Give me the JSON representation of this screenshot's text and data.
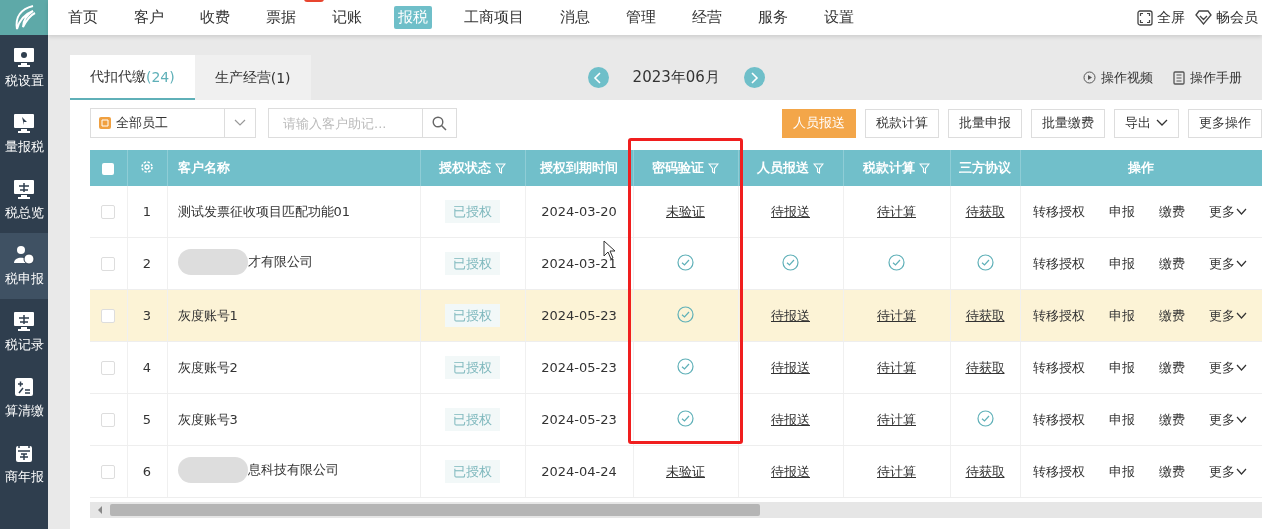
{
  "sidebar": {
    "items": [
      {
        "label": "税设置",
        "kind": "settings",
        "selected": false
      },
      {
        "label": "量报税",
        "kind": "batch",
        "selected": false
      },
      {
        "label": "税总览",
        "kind": "overview",
        "selected": false
      },
      {
        "label": "税申报",
        "kind": "declare",
        "selected": true
      },
      {
        "label": "税记录",
        "kind": "record",
        "selected": false
      },
      {
        "label": "算清缴",
        "kind": "settle",
        "selected": false
      },
      {
        "label": "商年报",
        "kind": "annual",
        "selected": false
      }
    ]
  },
  "nav": {
    "items": [
      {
        "label": "首页",
        "selected": false,
        "badge": false
      },
      {
        "label": "客户",
        "selected": false,
        "badge": false
      },
      {
        "label": "收费",
        "selected": false,
        "badge": false
      },
      {
        "label": "票据",
        "selected": false,
        "badge": true
      },
      {
        "label": "记账",
        "selected": false,
        "badge": false
      },
      {
        "label": "报税",
        "selected": true,
        "badge": false
      },
      {
        "label": "工商项目",
        "selected": false,
        "badge": false
      },
      {
        "label": "消息",
        "selected": false,
        "badge": false
      },
      {
        "label": "管理",
        "selected": false,
        "badge": false
      },
      {
        "label": "经营",
        "selected": false,
        "badge": false
      },
      {
        "label": "服务",
        "selected": false,
        "badge": false
      },
      {
        "label": "设置",
        "selected": false,
        "badge": false
      }
    ],
    "right": [
      {
        "label": "全屏",
        "kind": "fullscreen"
      },
      {
        "label": "畅会员",
        "kind": "vip"
      }
    ]
  },
  "tabs": [
    {
      "label": "代扣代缴",
      "count": "(24)",
      "selected": true
    },
    {
      "label": "生产经营",
      "count": "(1)",
      "selected": false
    }
  ],
  "period": "2023年06月",
  "help_links": [
    {
      "label": "操作视频",
      "kind": "video"
    },
    {
      "label": "操作手册",
      "kind": "manual"
    }
  ],
  "filter": {
    "value": "全部员工"
  },
  "search": {
    "placeholder": "请输入客户助记..."
  },
  "actions": [
    {
      "label": "人员报送",
      "primary": true,
      "dropdown": false
    },
    {
      "label": "税款计算",
      "primary": false,
      "dropdown": false
    },
    {
      "label": "批量申报",
      "primary": false,
      "dropdown": false
    },
    {
      "label": "批量缴费",
      "primary": false,
      "dropdown": false
    },
    {
      "label": "导出",
      "primary": false,
      "dropdown": true
    },
    {
      "label": "更多操作",
      "primary": false,
      "dropdown": false
    }
  ],
  "table": {
    "columns": [
      {
        "kind": "check",
        "checked": false
      },
      {
        "kind": "settings"
      },
      {
        "label": "客户名称",
        "filter": false,
        "highlighted": false
      },
      {
        "label": "授权状态",
        "filter": true,
        "highlighted": false
      },
      {
        "label": "授权到期时间",
        "filter": false,
        "highlighted": false
      },
      {
        "label": "密码验证",
        "filter": true,
        "highlighted": true
      },
      {
        "label": "人员报送",
        "filter": true,
        "highlighted": false
      },
      {
        "label": "税款计算",
        "filter": true,
        "highlighted": false
      },
      {
        "label": "三方协议",
        "filter": false,
        "highlighted": false
      },
      {
        "label": "操作",
        "filter": false,
        "highlighted": false
      }
    ],
    "rows": [
      {
        "checked": false,
        "highlighted": false,
        "no": "1",
        "name": "测试发票征收项目匹配功能01",
        "redacted": false,
        "auth": "已授权",
        "expiry": "2024-03-20",
        "status": [
          {
            "kind": "link",
            "text": "未验证"
          },
          {
            "kind": "link",
            "text": "待报送"
          },
          {
            "kind": "link",
            "text": "待计算"
          },
          {
            "kind": "link",
            "text": "待获取"
          }
        ],
        "ops": [
          "转移授权",
          "申报",
          "缴费",
          "更多"
        ]
      },
      {
        "checked": false,
        "highlighted": false,
        "no": "2",
        "name": "才有限公司",
        "redacted": true,
        "auth": "已授权",
        "expiry": "2024-03-21",
        "status": [
          {
            "kind": "check"
          },
          {
            "kind": "check"
          },
          {
            "kind": "check"
          },
          {
            "kind": "check"
          }
        ],
        "ops": [
          "转移授权",
          "申报",
          "缴费",
          "更多"
        ]
      },
      {
        "checked": false,
        "highlighted": true,
        "no": "3",
        "name": "灰度账号1",
        "redacted": false,
        "auth": "已授权",
        "expiry": "2024-05-23",
        "status": [
          {
            "kind": "check"
          },
          {
            "kind": "link",
            "text": "待报送"
          },
          {
            "kind": "link",
            "text": "待计算"
          },
          {
            "kind": "link",
            "text": "待获取"
          }
        ],
        "ops": [
          "转移授权",
          "申报",
          "缴费",
          "更多"
        ]
      },
      {
        "checked": false,
        "highlighted": false,
        "no": "4",
        "name": "灰度账号2",
        "redacted": false,
        "auth": "已授权",
        "expiry": "2024-05-23",
        "status": [
          {
            "kind": "check"
          },
          {
            "kind": "link",
            "text": "待报送"
          },
          {
            "kind": "link",
            "text": "待计算"
          },
          {
            "kind": "link",
            "text": "待获取"
          }
        ],
        "ops": [
          "转移授权",
          "申报",
          "缴费",
          "更多"
        ]
      },
      {
        "checked": false,
        "highlighted": false,
        "no": "5",
        "name": "灰度账号3",
        "redacted": false,
        "auth": "已授权",
        "expiry": "2024-05-23",
        "status": [
          {
            "kind": "check"
          },
          {
            "kind": "link",
            "text": "待报送"
          },
          {
            "kind": "link",
            "text": "待计算"
          },
          {
            "kind": "check"
          }
        ],
        "ops": [
          "转移授权",
          "申报",
          "缴费",
          "更多"
        ]
      },
      {
        "checked": false,
        "highlighted": false,
        "no": "6",
        "name": "息科技有限公司",
        "redacted": true,
        "auth": "已授权",
        "expiry": "2024-04-24",
        "status": [
          {
            "kind": "link",
            "text": "未验证"
          },
          {
            "kind": "link",
            "text": "待报送"
          },
          {
            "kind": "link",
            "text": "待计算"
          },
          {
            "kind": "link",
            "text": "待获取"
          }
        ],
        "ops": [
          "转移授权",
          "申报",
          "缴费",
          "更多"
        ]
      }
    ]
  }
}
